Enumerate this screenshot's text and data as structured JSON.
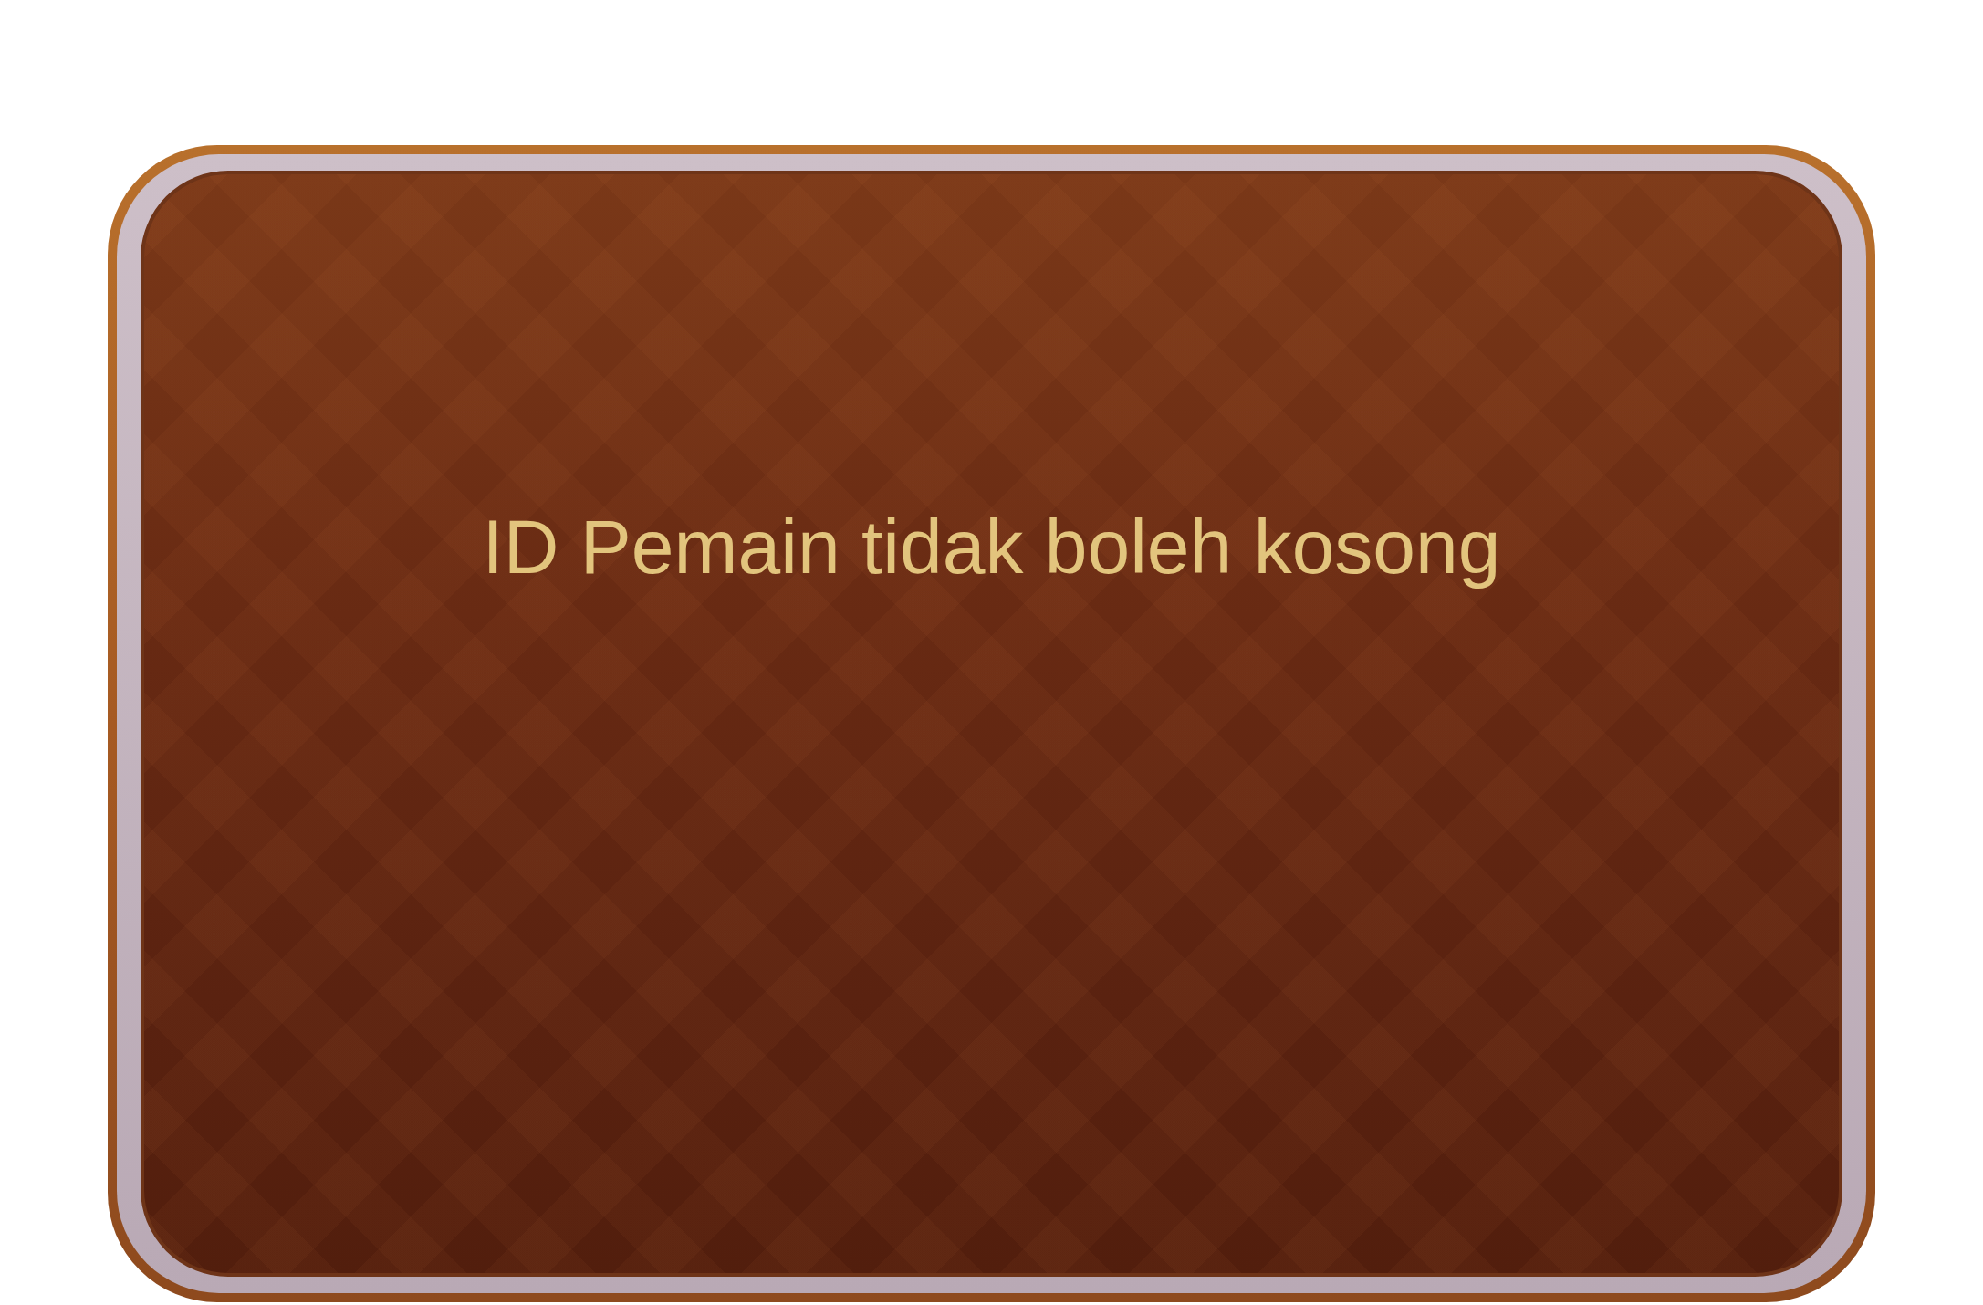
{
  "dialog": {
    "message": "ID Pemain tidak boleh kosong"
  }
}
